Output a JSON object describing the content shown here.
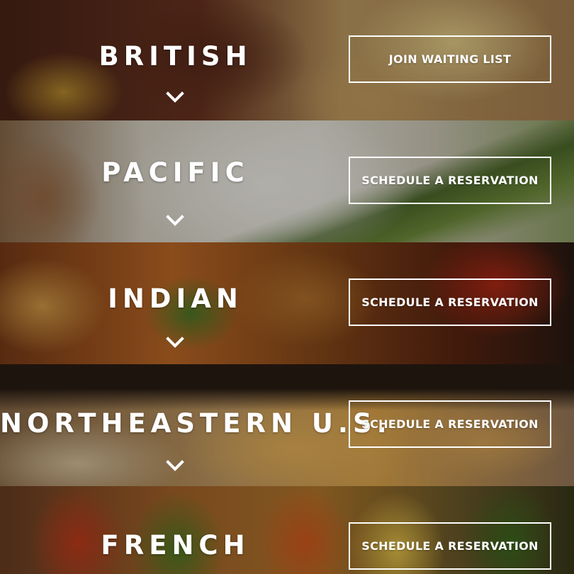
{
  "cuisines": [
    {
      "name": "BRITISH",
      "action": "JOIN WAITING LIST",
      "icon": "chevron-down-icon"
    },
    {
      "name": "PACIFIC",
      "action": "SCHEDULE A RESERVATION",
      "icon": "chevron-down-icon"
    },
    {
      "name": "INDIAN",
      "action": "SCHEDULE A RESERVATION",
      "icon": "chevron-down-icon"
    },
    {
      "name": "NORTHEASTERN U.S.",
      "action": "SCHEDULE A RESERVATION",
      "icon": "chevron-down-icon"
    },
    {
      "name": "FRENCH",
      "action": "SCHEDULE A RESERVATION"
    }
  ],
  "colors": {
    "text": "#ffffff",
    "button_border": "#ffffff"
  }
}
